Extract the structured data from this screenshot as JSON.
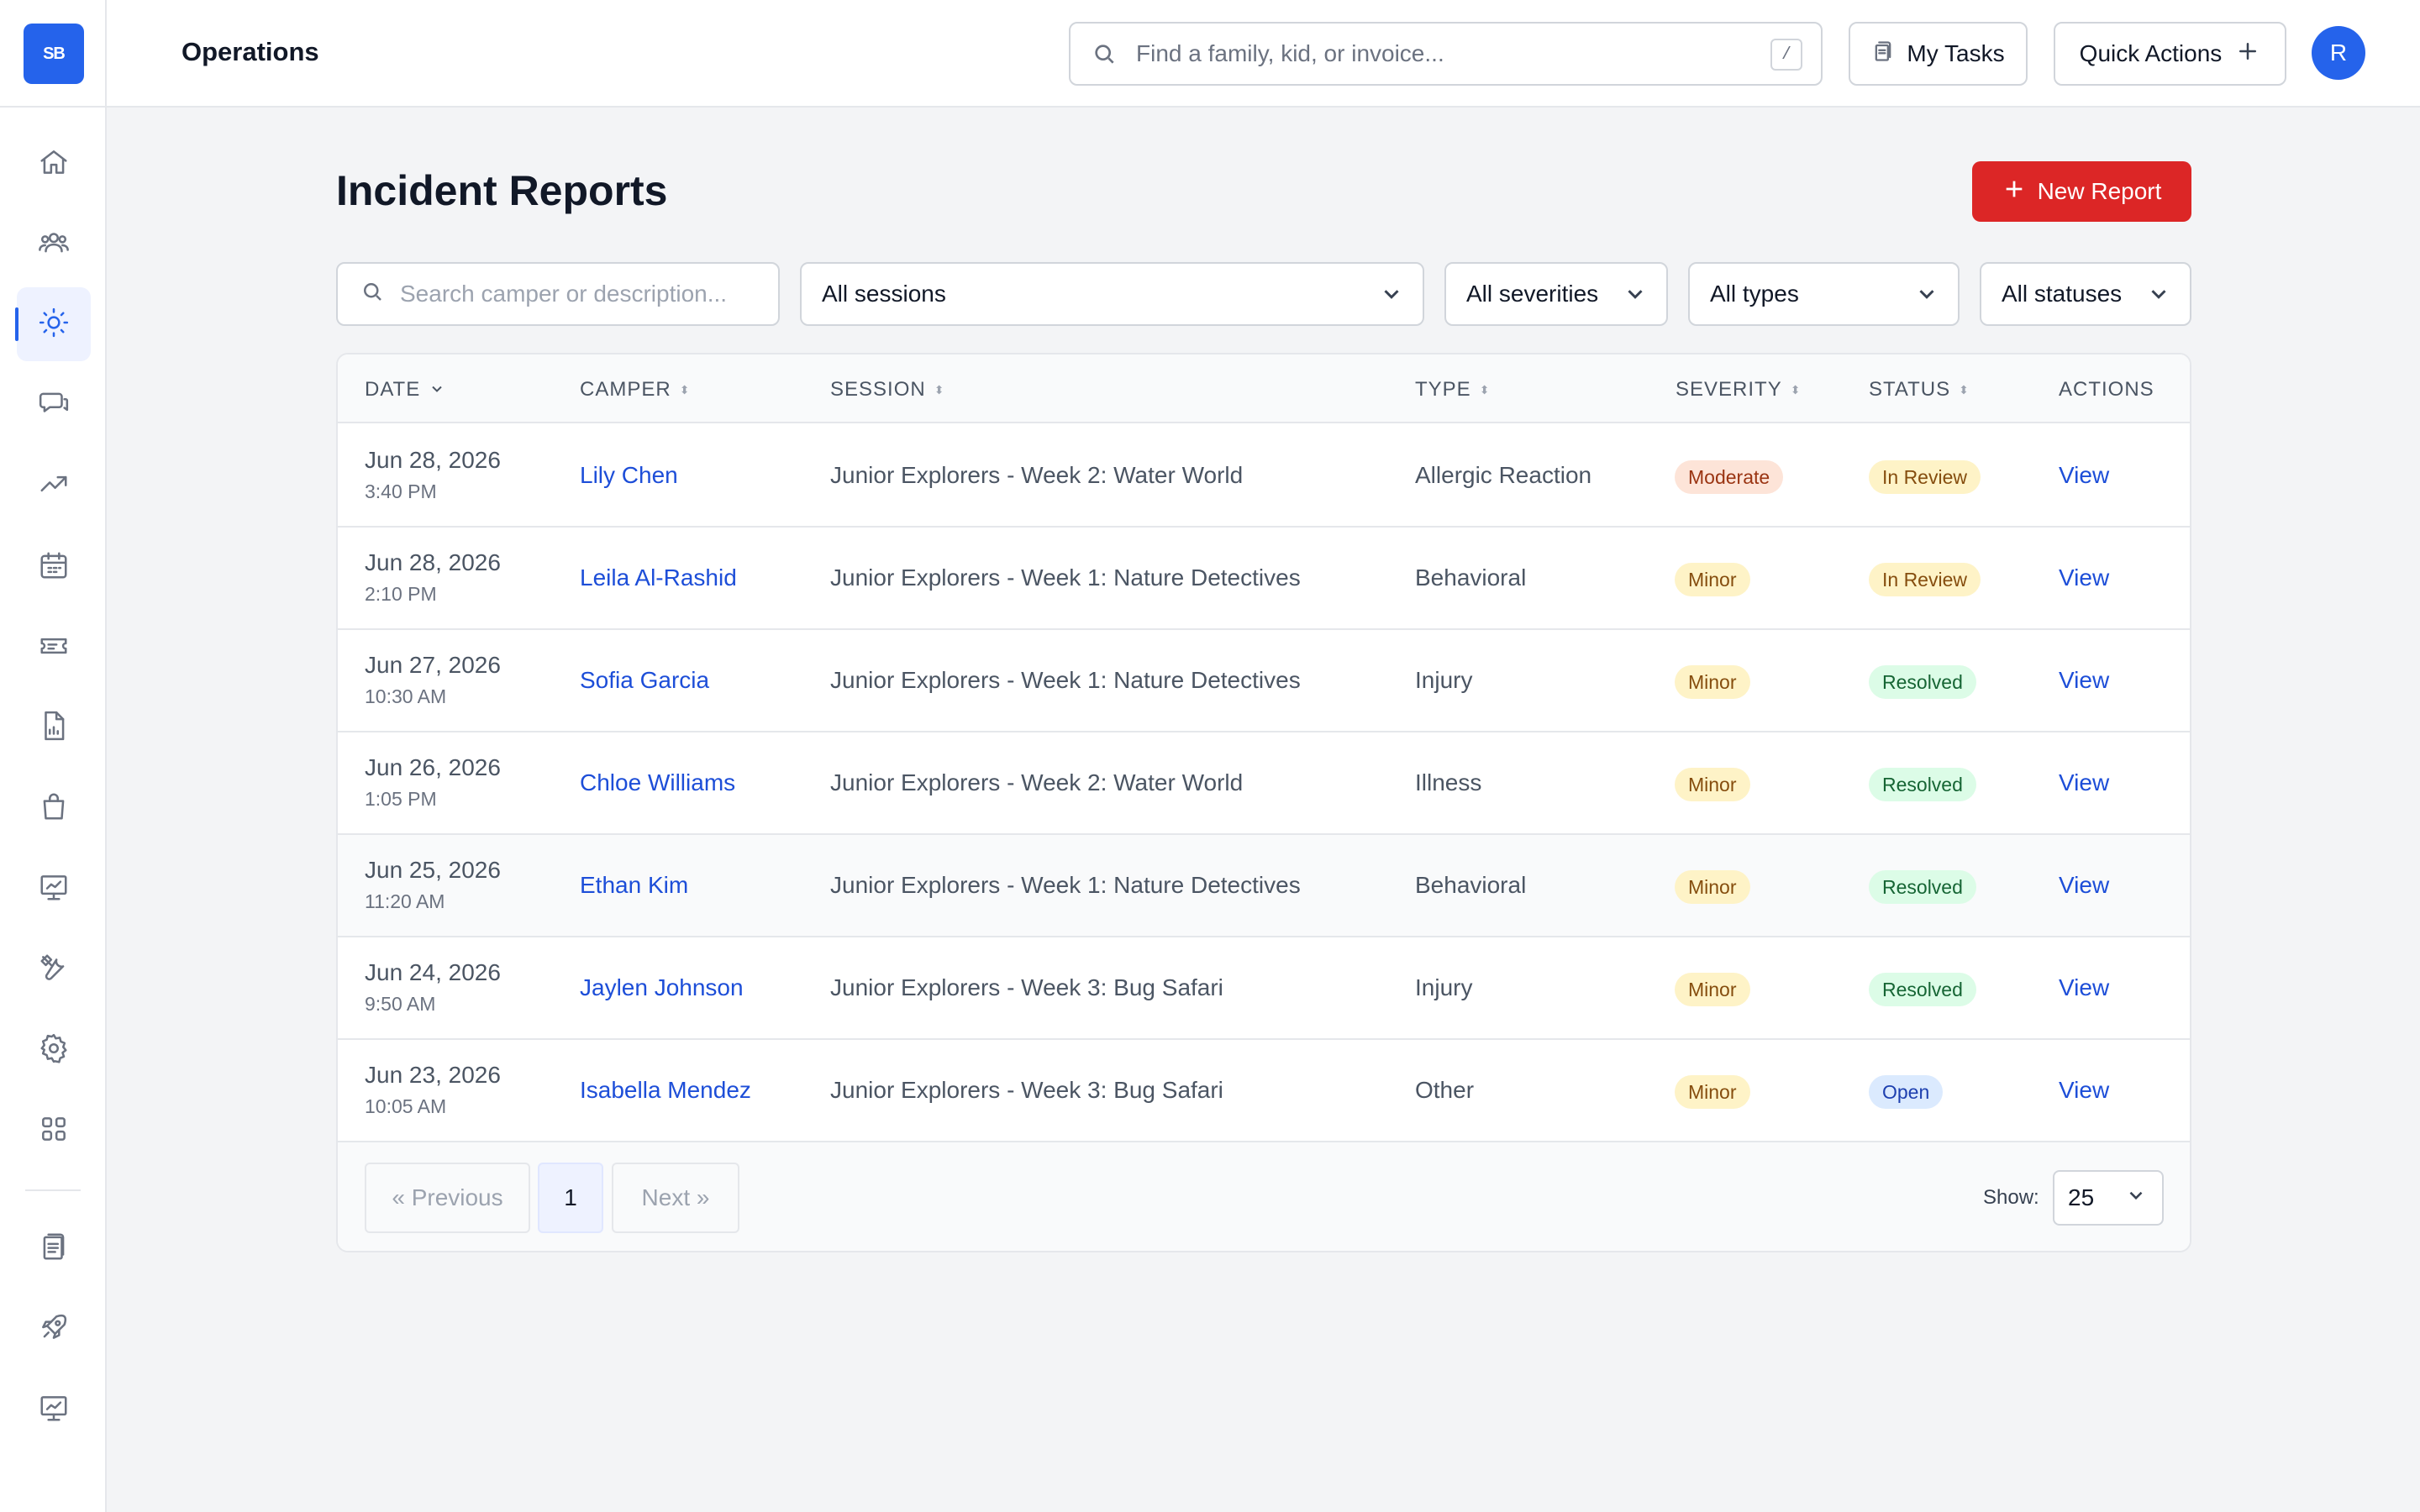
{
  "app": {
    "logo_text": "SB",
    "section_title": "Operations",
    "search_placeholder": "Find a family, kid, or invoice...",
    "search_shortcut": "/",
    "my_tasks_label": "My Tasks",
    "quick_actions_label": "Quick Actions",
    "avatar_initial": "R"
  },
  "sidebar": {
    "items": [
      {
        "icon": "home-icon"
      },
      {
        "icon": "users-group-icon"
      },
      {
        "icon": "sun-icon",
        "active": true
      },
      {
        "icon": "chat-bubbles-icon"
      },
      {
        "icon": "trending-up-icon"
      },
      {
        "icon": "calendar-icon"
      },
      {
        "icon": "ticket-icon"
      },
      {
        "icon": "report-document-icon"
      },
      {
        "icon": "shopping-bag-icon"
      },
      {
        "icon": "presentation-chart-icon"
      },
      {
        "icon": "tools-icon"
      },
      {
        "icon": "gear-icon"
      },
      {
        "icon": "apps-grid-icon"
      },
      {
        "icon": "clipboard-icon"
      },
      {
        "icon": "rocket-icon"
      },
      {
        "icon": "presentation-chart-icon"
      }
    ]
  },
  "page": {
    "title": "Incident Reports",
    "new_report_label": "New Report"
  },
  "filters": {
    "search_placeholder": "Search camper or description...",
    "sessions": "All sessions",
    "severities": "All severities",
    "types": "All types",
    "statuses": "All statuses"
  },
  "table": {
    "headers": {
      "date": "DATE",
      "camper": "CAMPER",
      "session": "SESSION",
      "type": "TYPE",
      "severity": "SEVERITY",
      "status": "STATUS",
      "actions": "ACTIONS"
    },
    "rows": [
      {
        "date": "Jun 28, 2026",
        "time": "3:40 PM",
        "camper": "Lily Chen",
        "session": "Junior Explorers - Week 2: Water World",
        "type": "Allergic Reaction",
        "severity": "Moderate",
        "status": "In Review",
        "action": "View"
      },
      {
        "date": "Jun 28, 2026",
        "time": "2:10 PM",
        "camper": "Leila Al-Rashid",
        "session": "Junior Explorers - Week 1: Nature Detectives",
        "type": "Behavioral",
        "severity": "Minor",
        "status": "In Review",
        "action": "View"
      },
      {
        "date": "Jun 27, 2026",
        "time": "10:30 AM",
        "camper": "Sofia Garcia",
        "session": "Junior Explorers - Week 1: Nature Detectives",
        "type": "Injury",
        "severity": "Minor",
        "status": "Resolved",
        "action": "View"
      },
      {
        "date": "Jun 26, 2026",
        "time": "1:05 PM",
        "camper": "Chloe Williams",
        "session": "Junior Explorers - Week 2: Water World",
        "type": "Illness",
        "severity": "Minor",
        "status": "Resolved",
        "action": "View"
      },
      {
        "date": "Jun 25, 2026",
        "time": "11:20 AM",
        "camper": "Ethan Kim",
        "session": "Junior Explorers - Week 1: Nature Detectives",
        "type": "Behavioral",
        "severity": "Minor",
        "status": "Resolved",
        "action": "View"
      },
      {
        "date": "Jun 24, 2026",
        "time": "9:50 AM",
        "camper": "Jaylen Johnson",
        "session": "Junior Explorers - Week 3: Bug Safari",
        "type": "Injury",
        "severity": "Minor",
        "status": "Resolved",
        "action": "View"
      },
      {
        "date": "Jun 23, 2026",
        "time": "10:05 AM",
        "camper": "Isabella Mendez",
        "session": "Junior Explorers - Week 3: Bug Safari",
        "type": "Other",
        "severity": "Minor",
        "status": "Open",
        "action": "View"
      }
    ]
  },
  "pagination": {
    "previous": "« Previous",
    "current_page": "1",
    "next": "Next »",
    "show_label": "Show:",
    "page_size": "25"
  },
  "colors": {
    "primary": "#2563eb",
    "danger": "#dc2626",
    "link": "#1d4ed8"
  }
}
